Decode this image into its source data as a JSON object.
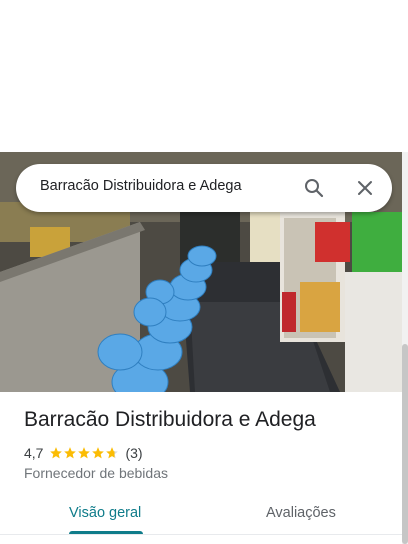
{
  "search": {
    "query": "Barracão Distribuidora e Adega",
    "search_icon": "search-icon",
    "close_icon": "close-icon"
  },
  "place": {
    "title": "Barracão Distribuidora e Adega",
    "rating": "4,7",
    "rating_value": 4.7,
    "stars_max": 5,
    "review_count": "(3)",
    "category": "Fornecedor de bebidas",
    "photo_description_icon": "store-photo"
  },
  "tabs": [
    {
      "label": "Visão geral",
      "active": true
    },
    {
      "label": "Avaliações",
      "active": false
    }
  ],
  "colors": {
    "accent": "#0f7c8a",
    "star": "#fbbc04",
    "text": "#202124",
    "secondary_text": "#70757a"
  }
}
